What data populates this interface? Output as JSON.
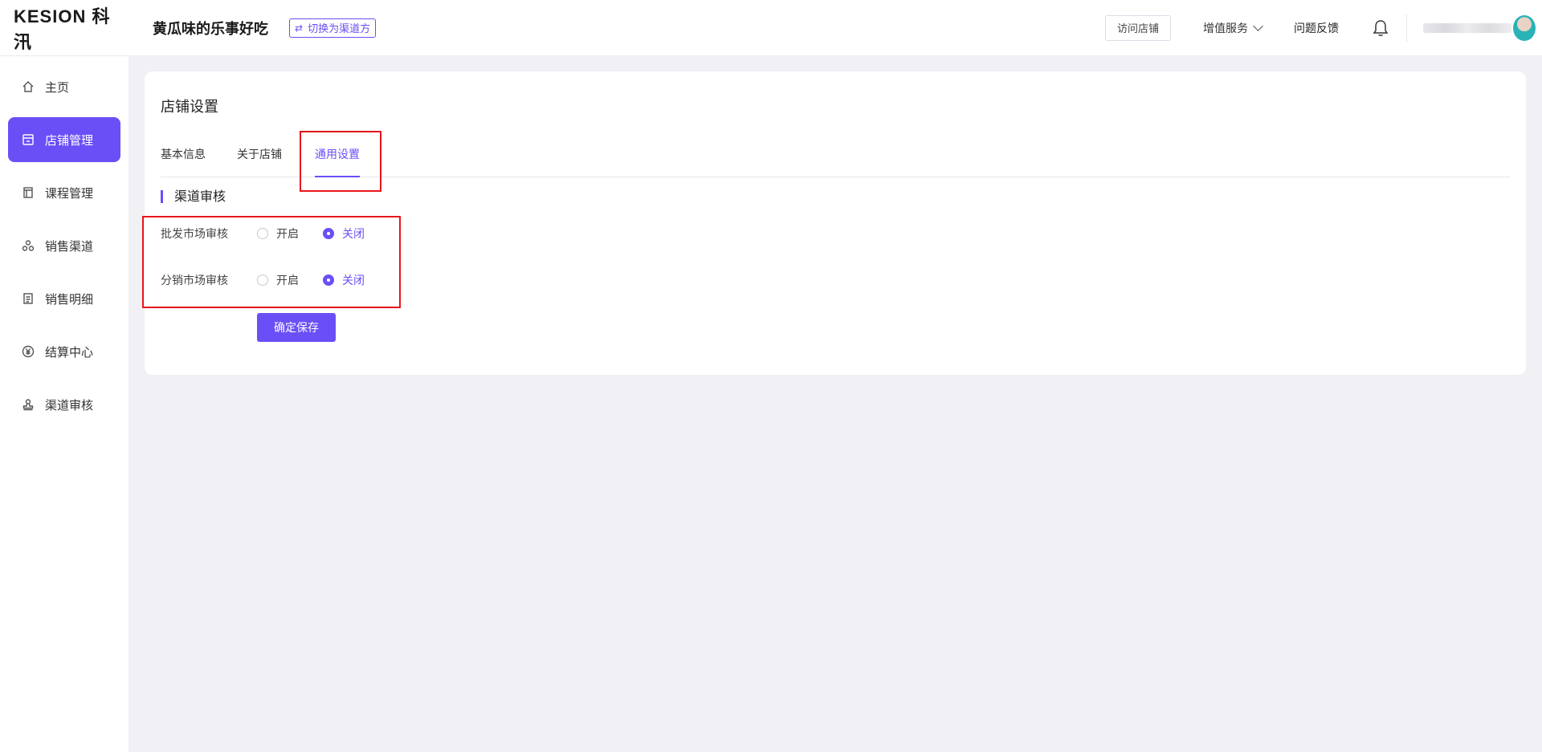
{
  "header": {
    "logo_text": "KESION 科汛",
    "shop_name": "黄瓜味的乐事好吃",
    "switch_icon": "⇄",
    "switch_label": "切换为渠道方",
    "visit_store": "访问店铺",
    "value_added": "增值服务",
    "feedback": "问题反馈"
  },
  "sidebar": {
    "items": [
      {
        "label": "主页",
        "icon": "home-icon"
      },
      {
        "label": "店铺管理",
        "icon": "store-icon",
        "active": true
      },
      {
        "label": "课程管理",
        "icon": "course-icon"
      },
      {
        "label": "销售渠道",
        "icon": "channel-icon"
      },
      {
        "label": "销售明细",
        "icon": "detail-icon"
      },
      {
        "label": "结算中心",
        "icon": "yuan-icon"
      },
      {
        "label": "渠道审核",
        "icon": "stamp-icon"
      }
    ]
  },
  "main": {
    "title": "店铺设置",
    "tabs": [
      {
        "label": "基本信息"
      },
      {
        "label": "关于店铺"
      },
      {
        "label": "通用设置",
        "active": true
      }
    ],
    "section_title": "渠道审核",
    "settings": [
      {
        "label": "批发市场审核",
        "options": [
          "开启",
          "关闭"
        ],
        "selected": "关闭"
      },
      {
        "label": "分销市场审核",
        "options": [
          "开启",
          "关闭"
        ],
        "selected": "关闭"
      }
    ],
    "save_button": "确定保存"
  },
  "colors": {
    "accent": "#6b4ff6",
    "highlight": "#e8161b",
    "background": "#f0f0f5"
  }
}
